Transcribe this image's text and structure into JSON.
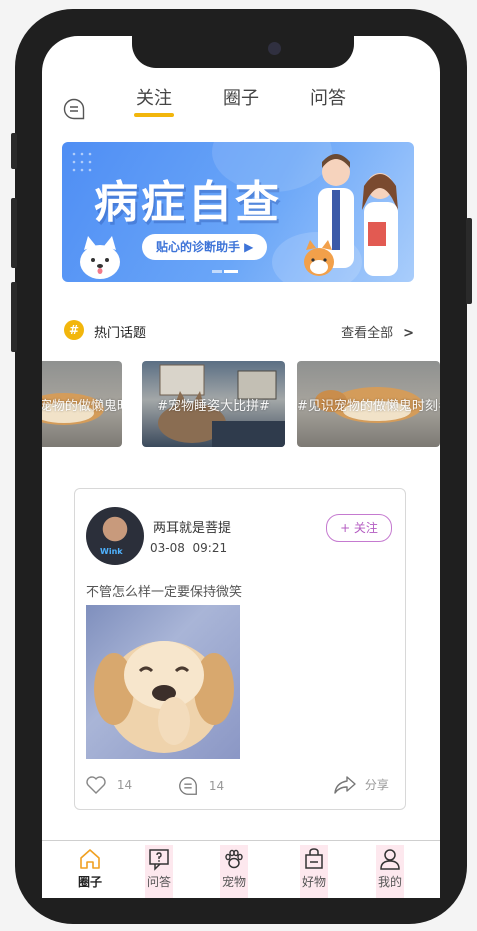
{
  "top_tabs": [
    {
      "label": "关注",
      "active": true
    },
    {
      "label": "圈子",
      "active": false
    },
    {
      "label": "问答",
      "active": false
    }
  ],
  "banner": {
    "title": "病症自查",
    "subtitle": "贴心的诊断助手 ▶"
  },
  "topics": {
    "title": "热门话题",
    "see_all": "查看全部",
    "see_all_chevron": ">",
    "cards": [
      {
        "label": "#见识宠物的做懒鬼时刻#"
      },
      {
        "label": "#宠物睡姿大比拼#"
      },
      {
        "label": "#见识宠物的做懒鬼时刻#"
      }
    ]
  },
  "post": {
    "username": "两耳就是菩提",
    "avatar_caption": "Wink",
    "date": "03-08",
    "time": "09:21",
    "follow_label": "+ 关注",
    "text": "不管怎么样一定要保持微笑",
    "likes": "14",
    "comments": "14",
    "share_label": "分享"
  },
  "bottom_nav": [
    {
      "label": "圈子",
      "icon": "home-icon",
      "active": true
    },
    {
      "label": "问答",
      "icon": "question-icon",
      "active": false
    },
    {
      "label": "宠物",
      "icon": "paw-icon",
      "active": false
    },
    {
      "label": "好物",
      "icon": "bag-icon",
      "active": false
    },
    {
      "label": "我的",
      "icon": "user-icon",
      "active": false
    }
  ],
  "colors": {
    "accent_yellow": "#f2b60c",
    "follow_purple": "#b45cc2",
    "banner_blue": "#4f8ef4",
    "nav_active_orange": "#f0a020"
  }
}
